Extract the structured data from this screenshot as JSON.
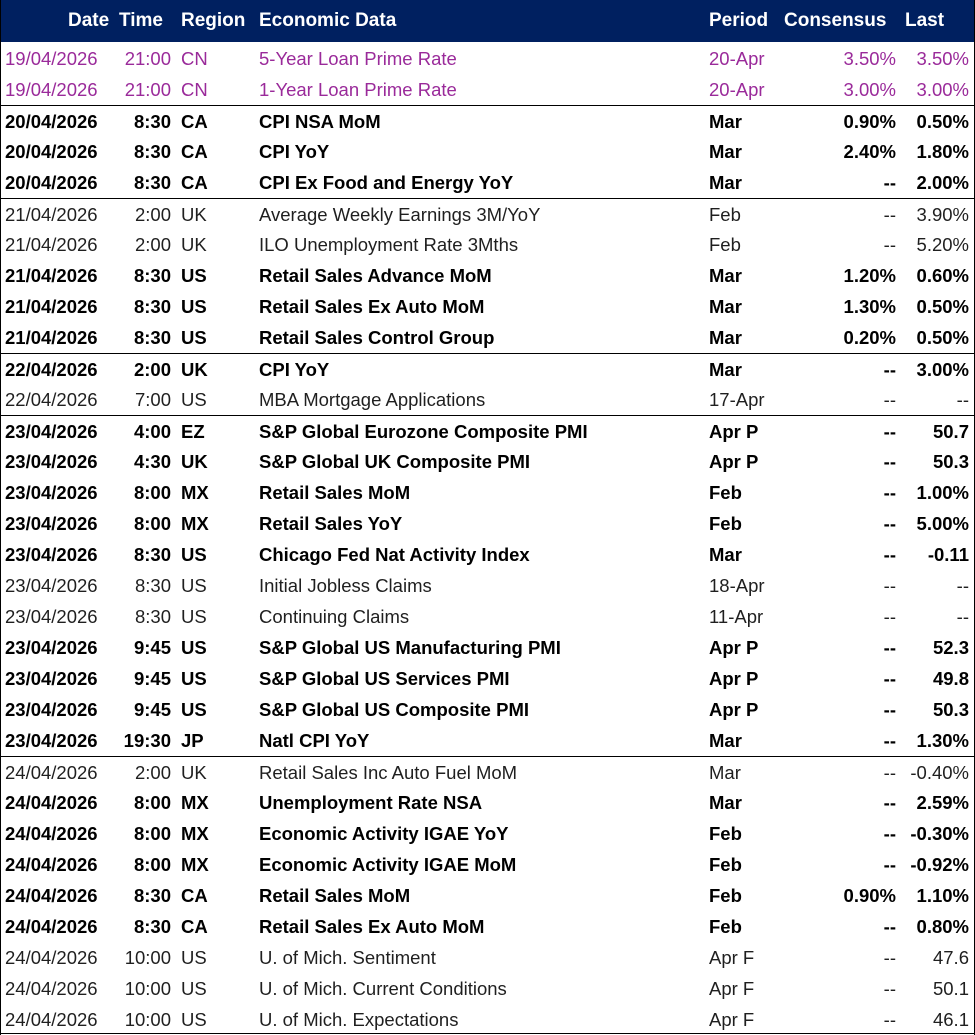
{
  "header": {
    "date": "Date",
    "time": "Time",
    "region": "Region",
    "data": "Economic Data",
    "period": "Period",
    "consensus": "Consensus",
    "last": "Last"
  },
  "colors": {
    "header_bg": "#002060",
    "header_text": "#ffffff",
    "china_text": "#9a2a9a"
  },
  "rows": [
    {
      "date": "19/04/2026",
      "time": "21:00",
      "region": "CN",
      "data": "5-Year Loan Prime Rate",
      "period": "20-Apr",
      "consensus": "3.50%",
      "last": "3.50%",
      "style": "china",
      "sep": false
    },
    {
      "date": "19/04/2026",
      "time": "21:00",
      "region": "CN",
      "data": "1-Year Loan Prime Rate",
      "period": "20-Apr",
      "consensus": "3.00%",
      "last": "3.00%",
      "style": "china",
      "sep": false
    },
    {
      "date": "20/04/2026",
      "time": "8:30",
      "region": "CA",
      "data": "CPI NSA MoM",
      "period": "Mar",
      "consensus": "0.90%",
      "last": "0.50%",
      "style": "bold",
      "sep": true
    },
    {
      "date": "20/04/2026",
      "time": "8:30",
      "region": "CA",
      "data": "CPI YoY",
      "period": "Mar",
      "consensus": "2.40%",
      "last": "1.80%",
      "style": "bold",
      "sep": false
    },
    {
      "date": "20/04/2026",
      "time": "8:30",
      "region": "CA",
      "data": "CPI Ex Food and Energy YoY",
      "period": "Mar",
      "consensus": "--",
      "last": "2.00%",
      "style": "bold",
      "sep": false
    },
    {
      "date": "21/04/2026",
      "time": "2:00",
      "region": "UK",
      "data": "Average Weekly Earnings 3M/YoY",
      "period": "Feb",
      "consensus": "--",
      "last": "3.90%",
      "style": "normal",
      "sep": true
    },
    {
      "date": "21/04/2026",
      "time": "2:00",
      "region": "UK",
      "data": "ILO Unemployment Rate 3Mths",
      "period": "Feb",
      "consensus": "--",
      "last": "5.20%",
      "style": "normal",
      "sep": false
    },
    {
      "date": "21/04/2026",
      "time": "8:30",
      "region": "US",
      "data": "Retail Sales Advance MoM",
      "period": "Mar",
      "consensus": "1.20%",
      "last": "0.60%",
      "style": "bold",
      "sep": false
    },
    {
      "date": "21/04/2026",
      "time": "8:30",
      "region": "US",
      "data": "Retail Sales Ex Auto MoM",
      "period": "Mar",
      "consensus": "1.30%",
      "last": "0.50%",
      "style": "bold",
      "sep": false
    },
    {
      "date": "21/04/2026",
      "time": "8:30",
      "region": "US",
      "data": "Retail Sales Control Group",
      "period": "Mar",
      "consensus": "0.20%",
      "last": "0.50%",
      "style": "bold",
      "sep": false
    },
    {
      "date": "22/04/2026",
      "time": "2:00",
      "region": "UK",
      "data": "CPI YoY",
      "period": "Mar",
      "consensus": "--",
      "last": "3.00%",
      "style": "bold",
      "sep": true
    },
    {
      "date": "22/04/2026",
      "time": "7:00",
      "region": "US",
      "data": "MBA Mortgage Applications",
      "period": "17-Apr",
      "consensus": "--",
      "last": "--",
      "style": "normal",
      "sep": false
    },
    {
      "date": "23/04/2026",
      "time": "4:00",
      "region": "EZ",
      "data": "S&P Global Eurozone Composite PMI",
      "period": "Apr P",
      "consensus": "--",
      "last": "50.7",
      "style": "bold",
      "sep": true
    },
    {
      "date": "23/04/2026",
      "time": "4:30",
      "region": "UK",
      "data": "S&P Global UK Composite PMI",
      "period": "Apr P",
      "consensus": "--",
      "last": "50.3",
      "style": "bold",
      "sep": false
    },
    {
      "date": "23/04/2026",
      "time": "8:00",
      "region": "MX",
      "data": "Retail Sales MoM",
      "period": "Feb",
      "consensus": "--",
      "last": "1.00%",
      "style": "bold",
      "sep": false
    },
    {
      "date": "23/04/2026",
      "time": "8:00",
      "region": "MX",
      "data": "Retail Sales YoY",
      "period": "Feb",
      "consensus": "--",
      "last": "5.00%",
      "style": "bold",
      "sep": false
    },
    {
      "date": "23/04/2026",
      "time": "8:30",
      "region": "US",
      "data": "Chicago Fed Nat Activity Index",
      "period": "Mar",
      "consensus": "--",
      "last": "-0.11",
      "style": "bold",
      "sep": false
    },
    {
      "date": "23/04/2026",
      "time": "8:30",
      "region": "US",
      "data": "Initial Jobless Claims",
      "period": "18-Apr",
      "consensus": "--",
      "last": "--",
      "style": "normal",
      "sep": false
    },
    {
      "date": "23/04/2026",
      "time": "8:30",
      "region": "US",
      "data": "Continuing Claims",
      "period": "11-Apr",
      "consensus": "--",
      "last": "--",
      "style": "normal",
      "sep": false
    },
    {
      "date": "23/04/2026",
      "time": "9:45",
      "region": "US",
      "data": "S&P Global US Manufacturing PMI",
      "period": "Apr P",
      "consensus": "--",
      "last": "52.3",
      "style": "bold",
      "sep": false
    },
    {
      "date": "23/04/2026",
      "time": "9:45",
      "region": "US",
      "data": "S&P Global US Services PMI",
      "period": "Apr P",
      "consensus": "--",
      "last": "49.8",
      "style": "bold",
      "sep": false
    },
    {
      "date": "23/04/2026",
      "time": "9:45",
      "region": "US",
      "data": "S&P Global US Composite PMI",
      "period": "Apr P",
      "consensus": "--",
      "last": "50.3",
      "style": "bold",
      "sep": false
    },
    {
      "date": "23/04/2026",
      "time": "19:30",
      "region": "JP",
      "data": "Natl CPI YoY",
      "period": "Mar",
      "consensus": "--",
      "last": "1.30%",
      "style": "bold",
      "sep": false
    },
    {
      "date": "24/04/2026",
      "time": "2:00",
      "region": "UK",
      "data": "Retail Sales Inc Auto Fuel MoM",
      "period": "Mar",
      "consensus": "--",
      "last": "-0.40%",
      "style": "normal",
      "sep": true
    },
    {
      "date": "24/04/2026",
      "time": "8:00",
      "region": "MX",
      "data": "Unemployment Rate NSA",
      "period": "Mar",
      "consensus": "--",
      "last": "2.59%",
      "style": "bold",
      "sep": false
    },
    {
      "date": "24/04/2026",
      "time": "8:00",
      "region": "MX",
      "data": "Economic Activity IGAE YoY",
      "period": "Feb",
      "consensus": "--",
      "last": "-0.30%",
      "style": "bold",
      "sep": false
    },
    {
      "date": "24/04/2026",
      "time": "8:00",
      "region": "MX",
      "data": "Economic Activity IGAE MoM",
      "period": "Feb",
      "consensus": "--",
      "last": "-0.92%",
      "style": "bold",
      "sep": false
    },
    {
      "date": "24/04/2026",
      "time": "8:30",
      "region": "CA",
      "data": "Retail Sales MoM",
      "period": "Feb",
      "consensus": "0.90%",
      "last": "1.10%",
      "style": "bold",
      "sep": false
    },
    {
      "date": "24/04/2026",
      "time": "8:30",
      "region": "CA",
      "data": "Retail Sales Ex Auto MoM",
      "period": "Feb",
      "consensus": "--",
      "last": "0.80%",
      "style": "bold",
      "sep": false
    },
    {
      "date": "24/04/2026",
      "time": "10:00",
      "region": "US",
      "data": "U. of Mich. Sentiment",
      "period": "Apr F",
      "consensus": "--",
      "last": "47.6",
      "style": "normal",
      "sep": false
    },
    {
      "date": "24/04/2026",
      "time": "10:00",
      "region": "US",
      "data": "U. of Mich. Current Conditions",
      "period": "Apr F",
      "consensus": "--",
      "last": "50.1",
      "style": "normal",
      "sep": false
    },
    {
      "date": "24/04/2026",
      "time": "10:00",
      "region": "US",
      "data": "U. of Mich. Expectations",
      "period": "Apr F",
      "consensus": "--",
      "last": "46.1",
      "style": "normal",
      "sep": false
    }
  ]
}
